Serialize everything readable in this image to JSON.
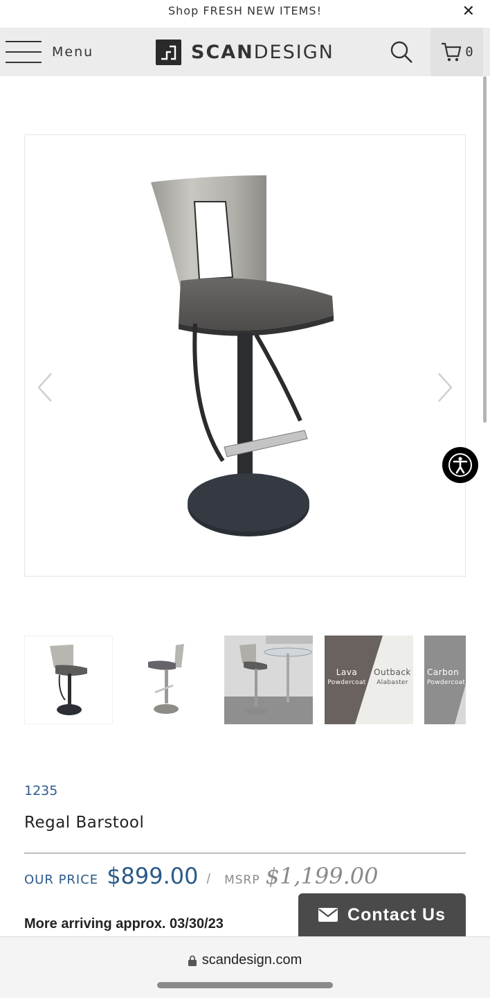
{
  "announcement": {
    "text": "Shop FRESH NEW ITEMS!",
    "close_icon": "close-icon"
  },
  "header": {
    "menu_label": "Menu",
    "logo_bold": "SCAN",
    "logo_light": "DESIGN",
    "cart_count": "0"
  },
  "product": {
    "sku": "1235",
    "title": "Regal Barstool",
    "our_price_label": "OUR PRICE",
    "our_price": "$899.00",
    "separator": "/",
    "msrp_label": "MSRP",
    "msrp_price": "$1,199.00",
    "arrival": "More arriving approx. 03/30/23"
  },
  "thumbnails": [
    {
      "name": "Lava",
      "sub": "Powdercoat"
    },
    {
      "name": "Outback",
      "sub": "Alabaster"
    },
    {
      "name": "Carbon",
      "sub": "Powdercoat"
    }
  ],
  "contact": {
    "label": "Contact Us"
  },
  "browser": {
    "url": "scandesign.com"
  },
  "colors": {
    "accent_blue": "#2b5a8a",
    "msrp_gray": "#8a8a8a",
    "contact_bg": "#4a4a4a"
  }
}
